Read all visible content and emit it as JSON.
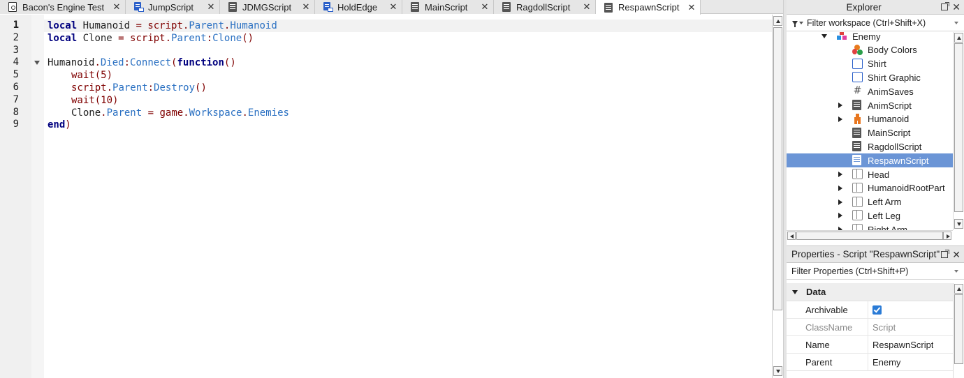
{
  "tabs": [
    {
      "label": "Bacon's Engine Test",
      "icon": "place-icon",
      "active": false
    },
    {
      "label": "JumpScript",
      "icon": "localscript-icon",
      "active": false
    },
    {
      "label": "JDMGScript",
      "icon": "script-icon",
      "active": false
    },
    {
      "label": "HoldEdge",
      "icon": "localscript-icon",
      "active": false
    },
    {
      "label": "MainScript",
      "icon": "script-icon",
      "active": false
    },
    {
      "label": "RagdollScript",
      "icon": "script-icon",
      "active": false
    },
    {
      "label": "RespawnScript",
      "icon": "script-icon",
      "active": true
    }
  ],
  "tab_close_glyph": "✕",
  "editor": {
    "current_line": 1,
    "lines": [
      {
        "n": "1",
        "indent": 0,
        "tokens": [
          [
            "kw",
            "local"
          ],
          [
            "id",
            " Humanoid "
          ],
          [
            "op",
            "="
          ],
          [
            "fn",
            " script"
          ],
          [
            "op",
            "."
          ],
          [
            "prop",
            "Parent"
          ],
          [
            "op",
            "."
          ],
          [
            "prop",
            "Humanoid"
          ]
        ]
      },
      {
        "n": "2",
        "indent": 0,
        "tokens": [
          [
            "kw",
            "local"
          ],
          [
            "id",
            " Clone "
          ],
          [
            "op",
            "="
          ],
          [
            "fn",
            " script"
          ],
          [
            "op",
            "."
          ],
          [
            "prop",
            "Parent"
          ],
          [
            "op",
            ":"
          ],
          [
            "prop",
            "Clone"
          ],
          [
            "op",
            "()"
          ]
        ]
      },
      {
        "n": "3",
        "indent": 0,
        "tokens": []
      },
      {
        "n": "4",
        "indent": 0,
        "fold": true,
        "tokens": [
          [
            "id",
            "Humanoid"
          ],
          [
            "op",
            "."
          ],
          [
            "prop",
            "Died"
          ],
          [
            "op",
            ":"
          ],
          [
            "prop",
            "Connect"
          ],
          [
            "op",
            "("
          ],
          [
            "kw",
            "function"
          ],
          [
            "op",
            "()"
          ]
        ]
      },
      {
        "n": "5",
        "indent": 1,
        "tokens": [
          [
            "fn",
            "wait"
          ],
          [
            "op",
            "("
          ],
          [
            "num",
            "5"
          ],
          [
            "op",
            ")"
          ]
        ]
      },
      {
        "n": "6",
        "indent": 1,
        "tokens": [
          [
            "fn",
            "script"
          ],
          [
            "op",
            "."
          ],
          [
            "prop",
            "Parent"
          ],
          [
            "op",
            ":"
          ],
          [
            "prop",
            "Destroy"
          ],
          [
            "op",
            "()"
          ]
        ]
      },
      {
        "n": "7",
        "indent": 1,
        "tokens": [
          [
            "fn",
            "wait"
          ],
          [
            "op",
            "("
          ],
          [
            "num",
            "10"
          ],
          [
            "op",
            ")"
          ]
        ]
      },
      {
        "n": "8",
        "indent": 1,
        "tokens": [
          [
            "id",
            "Clone"
          ],
          [
            "op",
            "."
          ],
          [
            "prop",
            "Parent"
          ],
          [
            "op",
            " = "
          ],
          [
            "fn",
            "game"
          ],
          [
            "op",
            "."
          ],
          [
            "prop",
            "Workspace"
          ],
          [
            "op",
            "."
          ],
          [
            "prop",
            "Enemies"
          ]
        ]
      },
      {
        "n": "9",
        "indent": 0,
        "tokens": [
          [
            "kw",
            "end"
          ],
          [
            "op",
            ")"
          ]
        ]
      }
    ]
  },
  "explorer": {
    "title": "Explorer",
    "filter_placeholder": "Filter workspace (Ctrl+Shift+X)",
    "items": [
      {
        "label": "Enemy",
        "icon": "model-icon",
        "depth": 0,
        "expander": "down"
      },
      {
        "label": "Body Colors",
        "icon": "body-colors-icon",
        "depth": 1,
        "expander": "none"
      },
      {
        "label": "Shirt",
        "icon": "shirt-icon",
        "depth": 1,
        "expander": "none"
      },
      {
        "label": "Shirt Graphic",
        "icon": "shirt-graphic-icon",
        "depth": 1,
        "expander": "none"
      },
      {
        "label": "AnimSaves",
        "icon": "hash-icon",
        "depth": 1,
        "expander": "none"
      },
      {
        "label": "AnimScript",
        "icon": "script-icon",
        "depth": 1,
        "expander": "right"
      },
      {
        "label": "Humanoid",
        "icon": "humanoid-icon",
        "depth": 1,
        "expander": "right"
      },
      {
        "label": "MainScript",
        "icon": "script-icon",
        "depth": 1,
        "expander": "none"
      },
      {
        "label": "RagdollScript",
        "icon": "script-icon",
        "depth": 1,
        "expander": "none"
      },
      {
        "label": "RespawnScript",
        "icon": "script-icon",
        "depth": 1,
        "expander": "none",
        "selected": true
      },
      {
        "label": "Head",
        "icon": "part-icon",
        "depth": 1,
        "expander": "right"
      },
      {
        "label": "HumanoidRootPart",
        "icon": "part-icon",
        "depth": 1,
        "expander": "right"
      },
      {
        "label": "Left Arm",
        "icon": "part-icon",
        "depth": 1,
        "expander": "right"
      },
      {
        "label": "Left Leg",
        "icon": "part-icon",
        "depth": 1,
        "expander": "right"
      },
      {
        "label": "Right Arm",
        "icon": "part-icon",
        "depth": 1,
        "expander": "right"
      }
    ]
  },
  "properties": {
    "title": "Properties - Script \"RespawnScript\"",
    "filter_placeholder": "Filter Properties (Ctrl+Shift+P)",
    "category": "Data",
    "rows": [
      {
        "name": "Archivable",
        "type": "checkbox",
        "checked": true,
        "value": ""
      },
      {
        "name": "ClassName",
        "type": "text",
        "value": "Script",
        "readonly": true
      },
      {
        "name": "Name",
        "type": "text",
        "value": "RespawnScript"
      },
      {
        "name": "Parent",
        "type": "text",
        "value": "Enemy"
      }
    ]
  },
  "colors": {
    "selection": "#6b95d6",
    "keyword": "#00007f",
    "operator": "#7f0000",
    "property": "#2a70c2"
  }
}
